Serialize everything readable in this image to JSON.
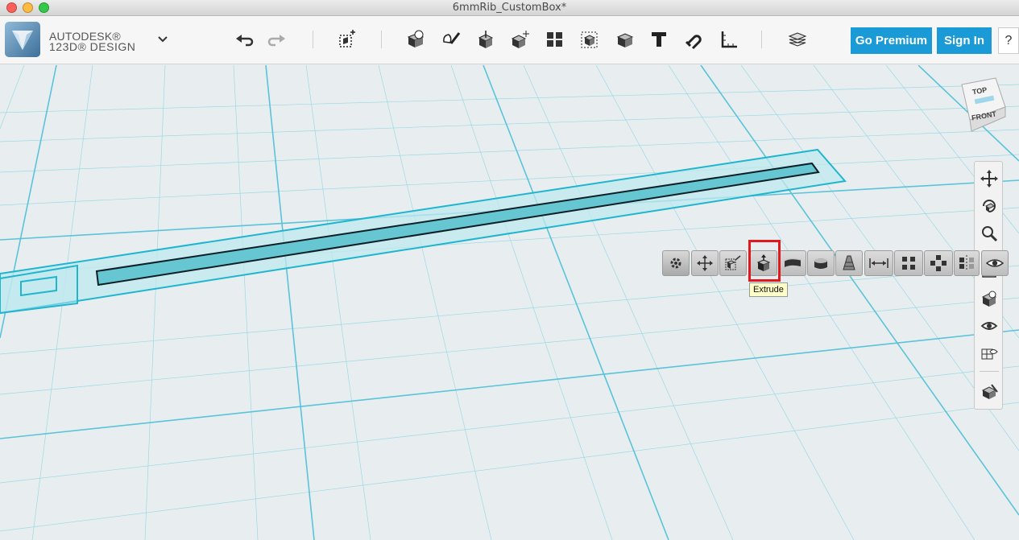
{
  "window": {
    "title": "6mmRib_CustomBox*"
  },
  "brand": {
    "line1": "AUTODESK®",
    "line2": "123D® DESIGN"
  },
  "toolbar": {
    "premium_label": "Go Premium",
    "signin_label": "Sign In",
    "help_label": "?"
  },
  "context_toolbar": {
    "tooltip": "Extrude",
    "highlight_color": "#e0191f"
  },
  "viewcube": {
    "top_label": "TOP",
    "front_label": "FRONT"
  },
  "colors": {
    "accent": "#1a9bd7",
    "grid": "#6cc8dc",
    "sketch_fill": "#66c6d2",
    "sketch_stroke": "#1fb5cf"
  }
}
